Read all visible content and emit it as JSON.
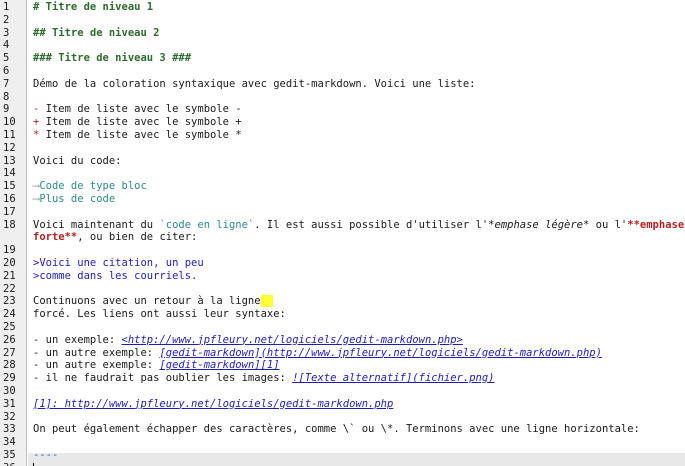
{
  "editor": {
    "line_numbers": [
      "1",
      "2",
      "3",
      "4",
      "5",
      "6",
      "7",
      "8",
      "9",
      "10",
      "11",
      "12",
      "13",
      "14",
      "15",
      "16",
      "17",
      "18",
      "",
      "19",
      "20",
      "21",
      "22",
      "23",
      "24",
      "25",
      "26",
      "27",
      "28",
      "29",
      "30",
      "31",
      "32",
      "33",
      "34",
      "35",
      "36"
    ],
    "lines": {
      "l1": "# Titre de niveau 1",
      "l3": "## Titre de niveau 2",
      "l5": "### Titre de niveau 3 ###",
      "l7": "Démo de la coloration syntaxique avec gedit-markdown. Voici une liste:",
      "l9_marker": "-",
      "l9_text": " Item de liste avec le symbole -",
      "l10_marker": "+",
      "l10_text": " Item de liste avec le symbole +",
      "l11_marker": "*",
      "l11_text": " Item de liste avec le symbole *",
      "l13": "Voici du code:",
      "l15_arrow": "⟶",
      "l15_code": "Code de type bloc",
      "l16_arrow": "⟶",
      "l16_code": "Plus de code",
      "l18_a": "Voici maintenant du ",
      "l18_code": "`code en ligne`",
      "l18_b": ". Il est aussi possible d'utiliser l'",
      "l18_em": "*emphase légère*",
      "l18_c": " ou l'",
      "l18_strong1": "**emphase",
      "l18_strong2": "forte**",
      "l18_d": ", ou bien de citer:",
      "l20": ">Voici une citation, un peu",
      "l21": ">comme dans les courriels.",
      "l23_text": "Continuons avec un retour à la ligne",
      "l23_br": "  ",
      "l24": "forcé. Les liens ont aussi leur syntaxe:",
      "l26_a": "- un exemple: ",
      "l26_link": "<http://www.jpfleury.net/logiciels/gedit-markdown.php>",
      "l27_a": "- un autre exemple: ",
      "l27_link": "[gedit-markdown](http://www.jpfleury.net/logiciels/gedit-markdown.php)",
      "l28_a": "- un autre exemple: ",
      "l28_link": "[gedit-markdown][1]",
      "l29_a": "- il ne faudrait pas oublier les images: ",
      "l29_link": "![Texte alternatif](fichier.png)",
      "l31": "[1]: http://www.jpfleury.net/logiciels/gedit-markdown.php",
      "l33": "On peut également échapper des caractères, comme \\` ou \\*. Terminons avec une ligne horizontale:",
      "l35": "----"
    }
  },
  "colors": {
    "heading": "#2e6b2e",
    "list_marker": "#b22222",
    "code": "#2e8b8b",
    "quote": "#1d1db8",
    "link": "#1d1db8",
    "strong": "#b22222",
    "linebreak_highlight": "#ffff33",
    "gutter_bg": "#efefef",
    "current_line_bg": "#e8e8e8"
  }
}
